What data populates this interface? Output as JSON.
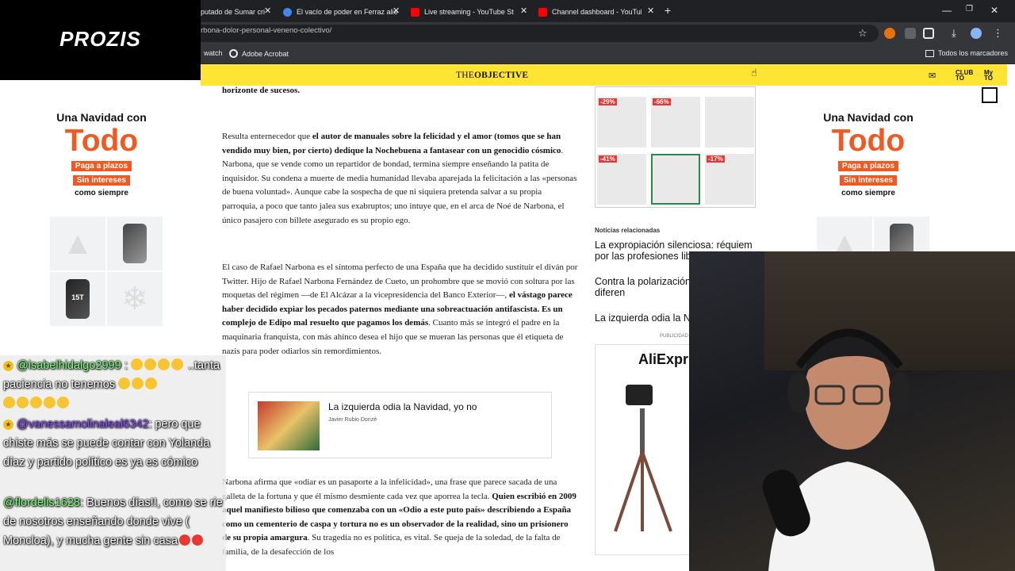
{
  "tabs": [
    {
      "label": "putado de Sumar cri",
      "color": "#e8eaed"
    },
    {
      "label": "El vacío de poder en Ferraz alie",
      "color": "#4285f4"
    },
    {
      "label": "Live streaming - YouTube Studi",
      "color": "#ff0000"
    },
    {
      "label": "Channel dashboard - YouTube",
      "color": "#ff0000"
    }
  ],
  "url": "rbona-dolor-personal-veneno-colectivo/",
  "bookmarks": {
    "watch": "watch",
    "acrobat": "Adobe Acrobat",
    "all": "Todos los marcadores"
  },
  "overlay_brand": "PROZIS",
  "site": {
    "logo_light": "THE",
    "logo_bold": "OBJECTIVE",
    "club": "CLUB TO",
    "my": "My TO"
  },
  "ad": {
    "line1": "Una Navidad con",
    "line2": "Todo",
    "pill1": "Paga a plazos",
    "pill2": "Sin intereses",
    "line3": "como siempre",
    "phone_label": "15T"
  },
  "article": {
    "p0": "horizonte de sucesos.",
    "p1_a": "Resulta enternecedor que ",
    "p1_b": "el autor de manuales sobre la felicidad y el amor (tomos que se han vendido muy bien, por cierto) dedique la Nochebuena a fantasear con un genocidio cósmico",
    "p1_c": ". Narbona, que se vende como un repartidor de bondad, termina siempre enseñando la patita de inquisidor. Su condena a muerte de media humanidad llevaba aparejada la felicitación a las «personas de buena voluntad». Aunque cabe la sospecha de que ni siquiera pretenda salvar a su propia parroquia, a poco que tanto jalea sus exabruptos; uno intuye que, en el arca de Noé de Narbona, el único pasajero con billete asegurado es su propio ego.",
    "p2_a": "El caso de Rafael Narbona es el síntoma perfecto de una España que ha decidido sustituir el diván por Twitter. Hijo de Rafael Narbona Fernández de Cueto, un prohombre que se movió con soltura por las moquetas del régimen —de El Alcázar a la vicepresidencia del Banco Exterior—, ",
    "p2_b": "el vástago parece haber decidido expiar los pecados paternos mediante una sobreactuación antifascista. Es un complejo de Edipo mal resuelto que pagamos los demás",
    "p2_c": ". Cuanto más se integró el padre en la maquinaria franquista, con más ahínco desea el hijo que se mueran las personas que él etiqueta de nazis para poder odiarlos sin remordimientos.",
    "p3_a": "Narbona afirma que «odiar es un pasaporte a la infelicidad», una frase que parece sacada de una galleta de la fortuna y que él mismo desmiente cada vez que aporrea la tecla. ",
    "p3_b": "Quien escribió en 2009 aquel manifiesto bilioso que comenzaba con un «Odio a este puto país» describiendo a España como un cementerio de caspa y tortura no es un observador de la realidad, sino un prisionero de su propia amargura",
    "p3_c": ". Su tragedia no es política, es vital. Se queja de la soledad, de la falta de familia, de la desafección de los"
  },
  "related": {
    "title": "La izquierda odia la Navidad, yo no",
    "author": "Javier Rubio Donzé"
  },
  "promo": {
    "d1": "-29%",
    "d2": "-66%",
    "d3": "-41%",
    "d4": "-17%"
  },
  "news": {
    "header": "Noticias relacionadas",
    "n1": "La expropiación silenciosa: réquiem por las profesiones lib",
    "n2": "Contra la polarización pensamos tan diferen",
    "n3": "La izquierda odia la N",
    "pub": "PUBLICIDAD",
    "ali": "AliExpr"
  },
  "chat": [
    {
      "user": "@isabelhidalgo2999",
      "text": " ..tanta paciencia no tenemos"
    },
    {
      "user": "@vanessamolinaleal6342",
      "text": ": pero que chiste más se puede contar con Yolanda díaz y partido político es ya es cómico"
    },
    {
      "user": "@flordelis1628",
      "text": ": Buenos días!!, como se rie de nosotros enseñando donde vive ( Moncloa), y mucha gente sin casa"
    }
  ],
  "colors": {
    "accent": "#ffe433",
    "ad_orange": "#f05a22",
    "chat_user": "#7dff7d"
  }
}
